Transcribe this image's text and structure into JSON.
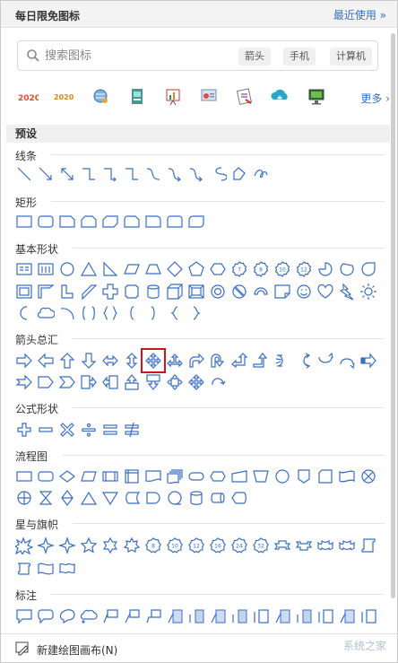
{
  "header": {
    "title": "每日限免图标",
    "recent_label": "最近使用"
  },
  "search": {
    "placeholder": "搜索图标",
    "tags": [
      "箭头",
      "手机",
      "计算机"
    ]
  },
  "icon_strip": {
    "items": [
      "2020-text-icon",
      "2020-gold-icon",
      "globe-icon",
      "document-icon",
      "chart-icon",
      "presentation-icon",
      "certificate-icon",
      "cloud-upload-icon",
      "monitor-icon"
    ],
    "more_label": "更多"
  },
  "preset_label": "预设",
  "sections": {
    "lines": "线条",
    "rectangles": "矩形",
    "basic": "基本形状",
    "arrows": "箭头总汇",
    "formula": "公式形状",
    "flowchart": "流程图",
    "stars": "星与旗帜",
    "callouts": "标注"
  },
  "badges": [
    "7",
    "8",
    "10",
    "12",
    "8",
    "10",
    "12",
    "16",
    "24",
    "32"
  ],
  "footer": {
    "label": "新建绘图画布(N)"
  },
  "watermark": "系统之家",
  "colors": {
    "shape_stroke": "#3a6fc4",
    "accent": "#3a6fc4",
    "selection": "#d0141b"
  }
}
